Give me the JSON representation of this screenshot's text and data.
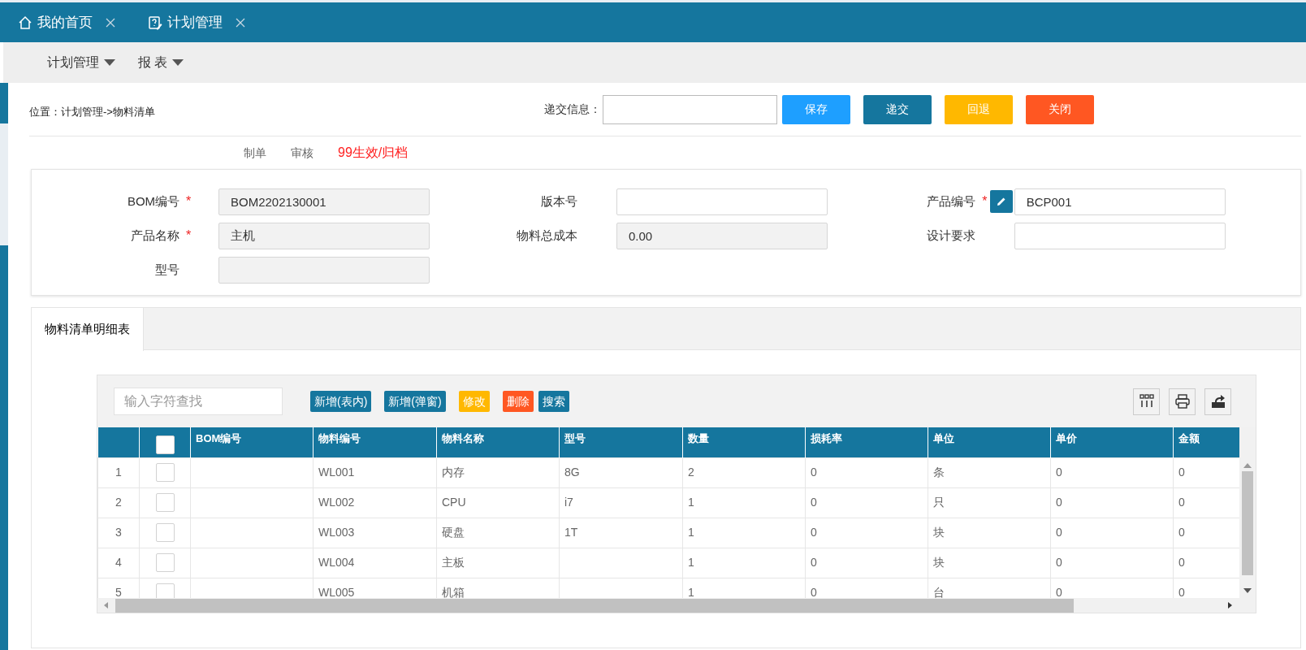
{
  "tabs": [
    {
      "label": "我的首页"
    },
    {
      "label": "计划管理"
    }
  ],
  "menu": [
    {
      "label": "计划管理"
    },
    {
      "label": "报 表"
    }
  ],
  "breadcrumb": "位置：计划管理->物料清单",
  "submit": {
    "label": "递交信息：",
    "buttons": [
      {
        "label": "保存",
        "color": "#1e9fff"
      },
      {
        "label": "递交",
        "color": "#15769e"
      },
      {
        "label": "回退",
        "color": "#ffb800"
      },
      {
        "label": "关闭",
        "color": "#ff5722"
      }
    ]
  },
  "steps": [
    {
      "label": "制单",
      "current": false
    },
    {
      "label": "审核",
      "current": false
    },
    {
      "label": "99生效/归档",
      "current": true
    }
  ],
  "form": {
    "rows": [
      [
        {
          "label": "BOM编号",
          "required_mark": "*",
          "value": "BOM2202130001",
          "readonly": true
        },
        {
          "label": "版本号",
          "readonly": false
        },
        {
          "label": "产品编号",
          "required_mark": "*",
          "value": "BCP001",
          "readonly": false,
          "edit_button": true
        }
      ],
      [
        {
          "label": "产品名称",
          "required_mark": "*",
          "value": "主机",
          "readonly": true
        },
        {
          "label": "物料总成本",
          "value": "0.00",
          "readonly": true
        },
        {
          "label": "设计要求",
          "readonly": false
        }
      ],
      [
        {
          "label": "型号",
          "readonly": true
        }
      ]
    ]
  },
  "detail_tabs": [
    {
      "label": "物料清单明细表",
      "selected": true
    }
  ],
  "grid": {
    "search": {
      "placeholder": "输入字符查找"
    },
    "buttons": [
      {
        "label": "新增(表内)",
        "color": "#15769e"
      },
      {
        "label": "新增(弹窗)",
        "color": "#15769e"
      },
      {
        "label": "修改",
        "color": "#ffb800"
      },
      {
        "label": "删除",
        "color": "#ff5722"
      },
      {
        "label": "搜索",
        "color": "#15769e"
      }
    ],
    "select_all": {
      "checked": false
    },
    "columns": [
      "BOM编号",
      "物料编号",
      "物料名称",
      "型号",
      "数量",
      "损耗率",
      "单位",
      "单价",
      "金额"
    ],
    "rows": [
      {
        "row_number": "1",
        "checked": false,
        "cells": [
          "",
          "WL001",
          "内存",
          "8G",
          "2",
          "0",
          "条",
          "0",
          "0"
        ]
      },
      {
        "row_number": "2",
        "checked": false,
        "cells": [
          "",
          "WL002",
          "CPU",
          "i7",
          "1",
          "0",
          "只",
          "0",
          "0"
        ]
      },
      {
        "row_number": "3",
        "checked": false,
        "cells": [
          "",
          "WL003",
          "硬盘",
          "1T",
          "1",
          "0",
          "块",
          "0",
          "0"
        ]
      },
      {
        "row_number": "4",
        "checked": false,
        "cells": [
          "",
          "WL004",
          "主板",
          "",
          "1",
          "0",
          "块",
          "0",
          "0"
        ]
      },
      {
        "row_number": "5",
        "checked": false,
        "cells": [
          "",
          "WL005",
          "机箱",
          "",
          "1",
          "0",
          "台",
          "0",
          "0"
        ]
      }
    ]
  }
}
